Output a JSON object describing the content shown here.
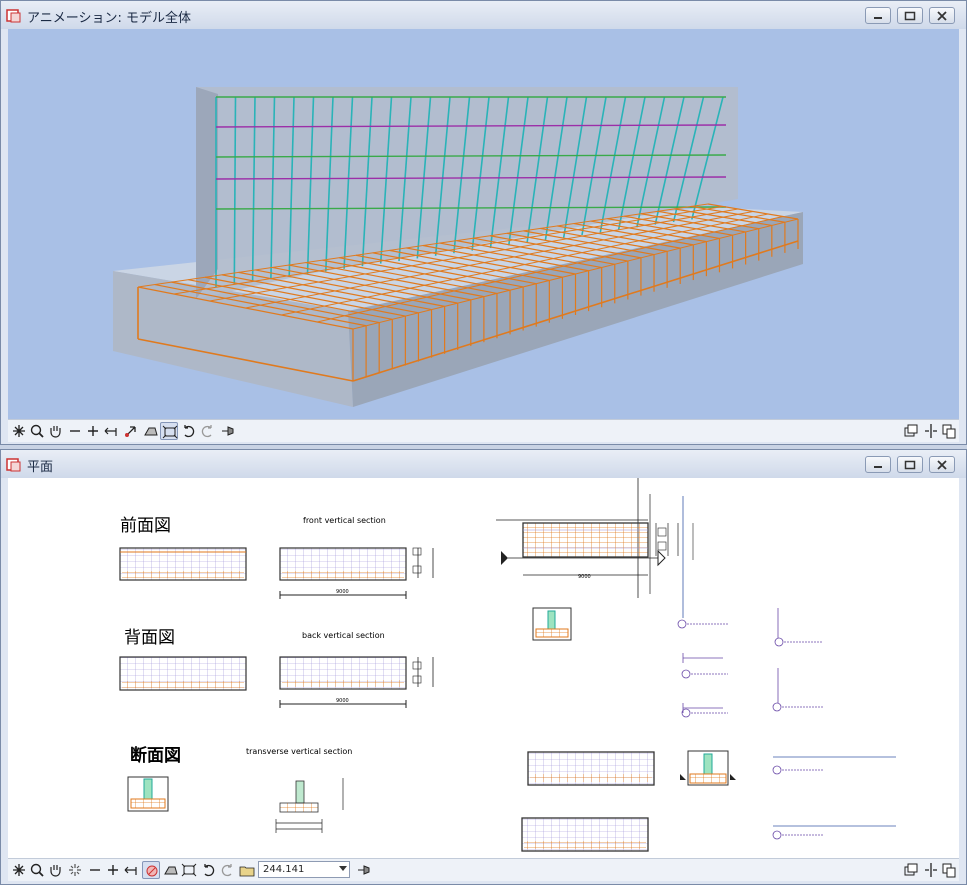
{
  "top_window": {
    "title": "アニメーション: モデル全体"
  },
  "bottom_window": {
    "title": "平面",
    "zoom_value": "244.141",
    "labels": {
      "front_jp": "前面図",
      "front_en": "front vertical section",
      "back_jp": "背面図",
      "back_en": "back vertical section",
      "trans_jp": "断面図",
      "trans_en": "transverse vertical section"
    },
    "dims": {
      "length": "9000"
    }
  },
  "colors": {
    "viewport_bg": "#a9c0e6",
    "drawing_bg": "#ffffff",
    "rebar_orange": "#e07a1e",
    "rebar_cyan": "#2ab3b8",
    "rebar_purple": "#9c2fa8",
    "rebar_green": "#3aaa4a",
    "concrete": "#b6c0d0"
  }
}
